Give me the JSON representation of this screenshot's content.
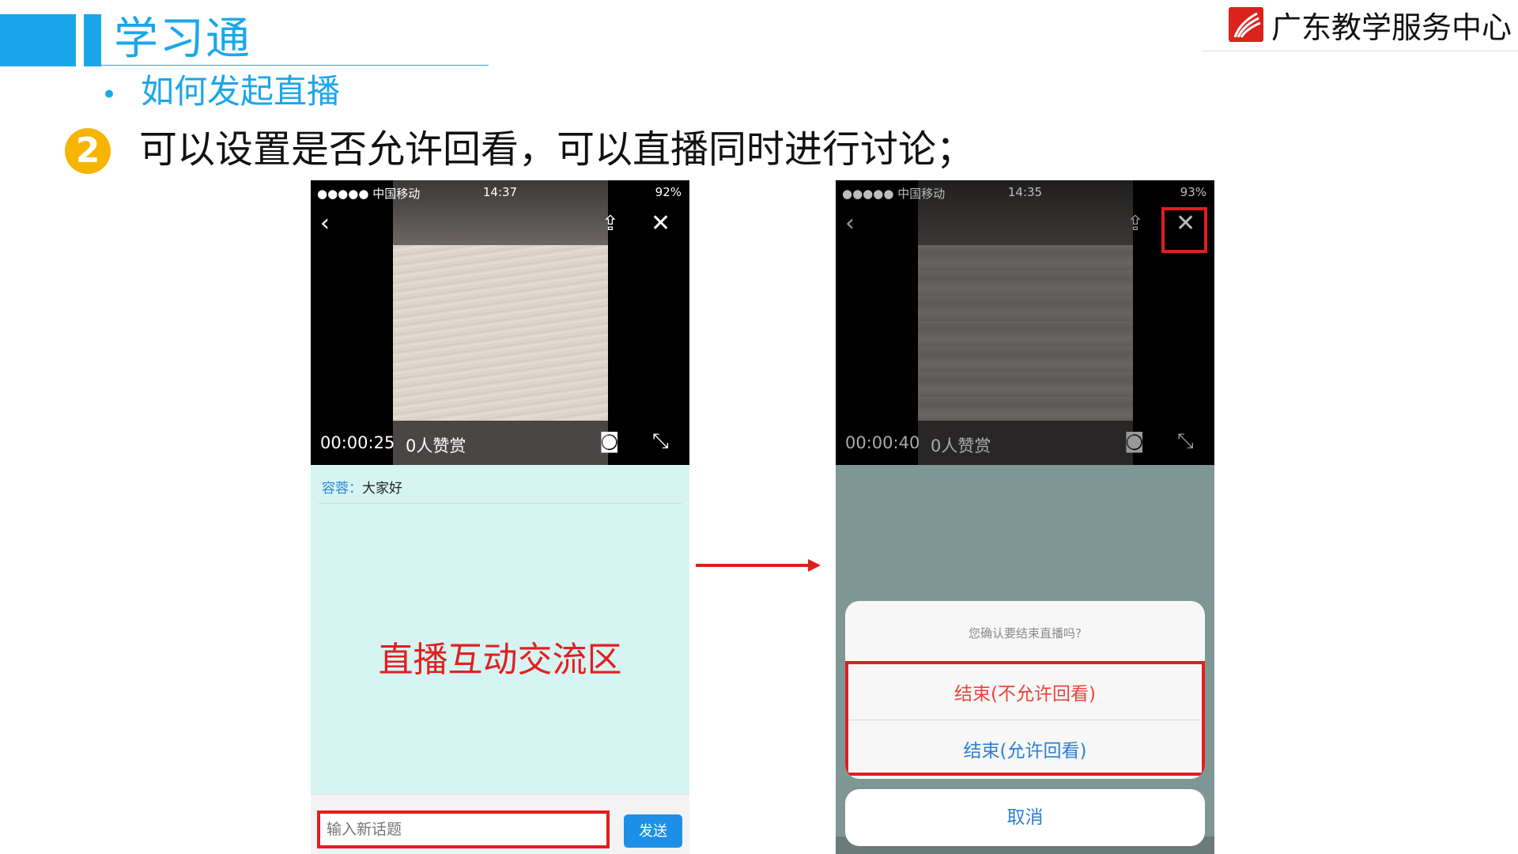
{
  "header": {
    "title": "学习通",
    "brand": "广东教学服务中心",
    "bullet": "如何发起直播",
    "step_number": "2",
    "step_text": "可以设置是否允许回看，可以直播同时进行讨论；"
  },
  "phone_left": {
    "status": {
      "carrier": "●●●●● 中国移动",
      "time": "14:37",
      "battery": "92%"
    },
    "video": {
      "elapsed": "00:00:25",
      "likes": "0人赞赏"
    },
    "chat": {
      "user": "容蓉：",
      "message": "大家好"
    },
    "area_label": "直播互动交流区",
    "input_placeholder": "输入新话题",
    "send_label": "发送"
  },
  "phone_right": {
    "status": {
      "carrier": "●●●●● 中国移动",
      "time": "14:35",
      "battery": "93%"
    },
    "video": {
      "elapsed": "00:00:40",
      "likes": "0人赞赏"
    },
    "sheet": {
      "title": "您确认要结束直播吗?",
      "option_no_replay": "结束(不允许回看)",
      "option_replay": "结束(允许回看)",
      "cancel": "取消"
    }
  },
  "colors": {
    "accent": "#1aa7ea",
    "highlight": "#e21d1d",
    "step": "#f7b500"
  }
}
